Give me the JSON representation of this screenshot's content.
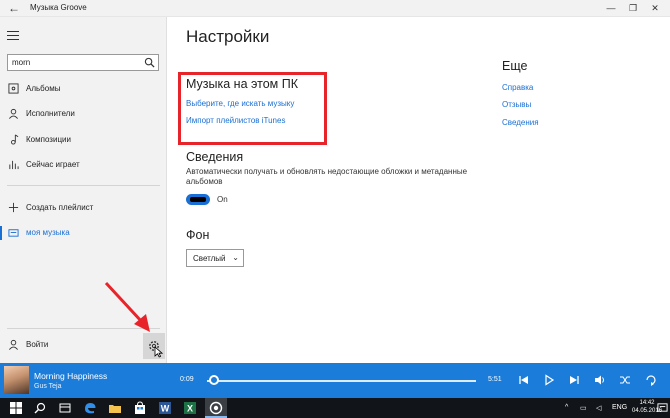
{
  "titlebar": {
    "app_title": "Музыка Groove",
    "back_icon": "arrow-left-icon",
    "minimize_glyph": "—",
    "maximize_glyph": "❐",
    "close_glyph": "✕"
  },
  "sidebar": {
    "search_value": "morn",
    "items": [
      {
        "label": "Альбомы",
        "icon": "album-icon"
      },
      {
        "label": "Исполнители",
        "icon": "person-icon"
      },
      {
        "label": "Композиции",
        "icon": "music-note-icon"
      },
      {
        "label": "Сейчас играет",
        "icon": "equalizer-icon"
      }
    ],
    "create_playlist": "Создать плейлист",
    "my_music": "моя музыка",
    "sign_in": "Войти"
  },
  "main": {
    "title": "Настройки",
    "music_section": {
      "heading": "Музыка на этом ПК",
      "choose_link": "Выберите, где искать музыку",
      "import_link": "Импорт плейлистов iTunes"
    },
    "info_section": {
      "heading": "Сведения",
      "description": "Автоматически получать и обновлять недостающие обложки и метаданные альбомов",
      "toggle_state": "On"
    },
    "background_section": {
      "heading": "Фон",
      "selected": "Светлый"
    },
    "more": {
      "heading": "Еще",
      "links": [
        "Справка",
        "Отзывы",
        "Сведения"
      ]
    }
  },
  "player": {
    "track_title": "Morning Happiness",
    "artist": "Gus Teja",
    "elapsed": "0:09",
    "duration": "5:51",
    "progress_fraction": 0.026
  },
  "taskbar": {
    "language": "ENG",
    "time": "14:42",
    "date": "04.05.2016"
  },
  "colors": {
    "accent": "#1a6fd4",
    "player_bg": "#1b7dd9",
    "highlight": "#e8242b",
    "taskbar": "#111418"
  }
}
